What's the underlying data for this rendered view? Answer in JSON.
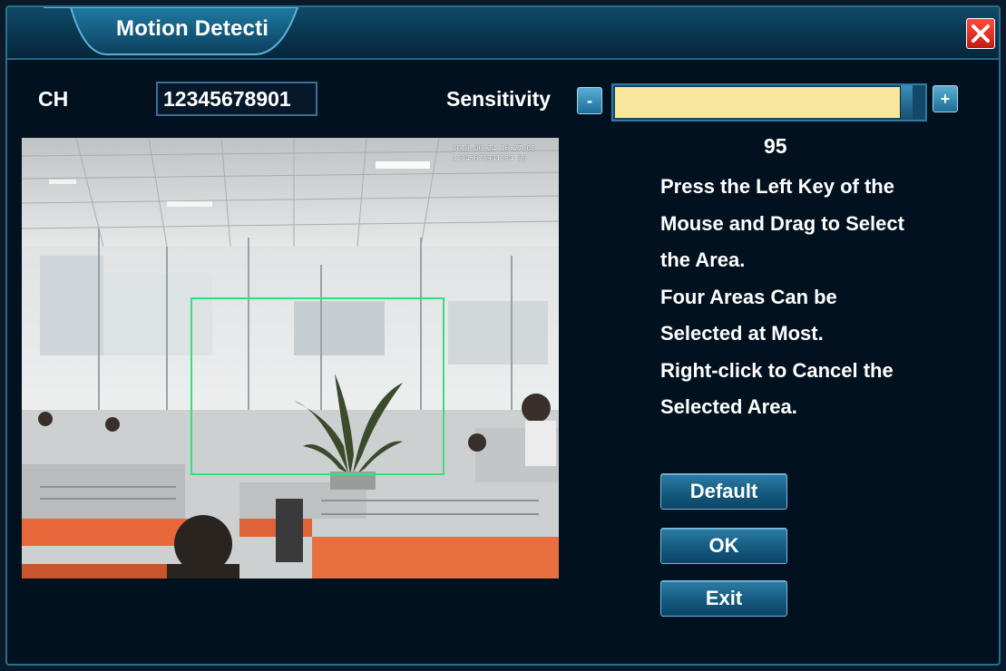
{
  "window": {
    "title": "Motion Detecti",
    "close_icon": "close-icon"
  },
  "channel": {
    "label": "CH",
    "value": "12345678901"
  },
  "sensitivity": {
    "label": "Sensitivity",
    "minus_label": "-",
    "plus_label": "+",
    "value": "95",
    "level_percent": 95
  },
  "camera": {
    "osd_line1": "2013-06-24 16:27:08",
    "osd_line2": "12345678901234 56"
  },
  "instructions": [
    "Press the Left Key of the",
    "Mouse and Drag to Select",
    "the Area.",
    "Four Areas Can be",
    "Selected at Most.",
    "Right-click to Cancel the",
    "Selected Area."
  ],
  "buttons": {
    "default_label": "Default",
    "ok_label": "OK",
    "exit_label": "Exit"
  },
  "colors": {
    "window_bg": "#02111f",
    "accent": "#2a6f8f",
    "slider_fill": "#f8e79a",
    "selection_box": "#35e07a",
    "close_red": "#e0281c"
  }
}
